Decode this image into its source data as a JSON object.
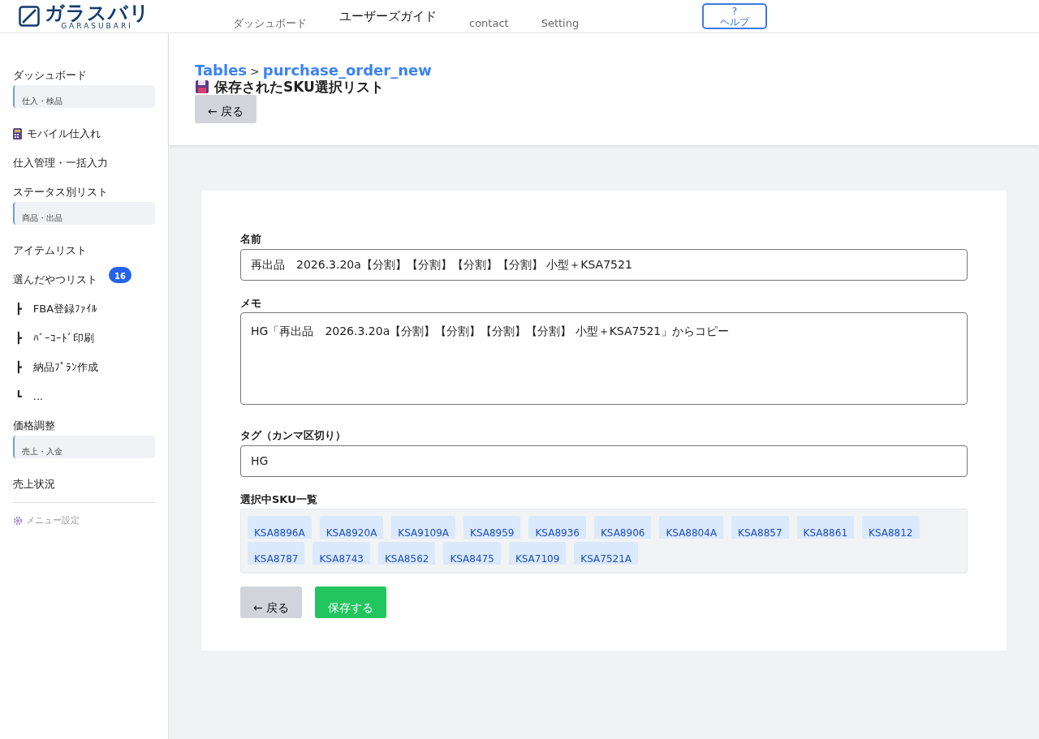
{
  "brand": {
    "name": "ガラスバリ",
    "subtitle": "GARASUBARI"
  },
  "topnav": [
    {
      "label": "ダッシュボード",
      "selected": false
    },
    {
      "label": "ユーザーズガイド",
      "selected": true
    },
    {
      "label": "contact",
      "selected": false
    },
    {
      "label": "Setting",
      "selected": false
    }
  ],
  "help_button": {
    "icon": "?",
    "label": "ヘルプ"
  },
  "sidebar": {
    "items": [
      {
        "kind": "link",
        "label": "ダッシュボード"
      },
      {
        "kind": "section",
        "label": "仕入・検品"
      },
      {
        "kind": "icon-link",
        "label": "モバイル仕入れ"
      },
      {
        "kind": "link",
        "label": "仕入管理・一括入力"
      },
      {
        "kind": "link",
        "label": "ステータス別リスト"
      },
      {
        "kind": "section",
        "label": "商品・出品"
      },
      {
        "kind": "link",
        "label": "アイテムリスト"
      },
      {
        "kind": "badge-link",
        "label": "選んだやつリスト",
        "badge": "16"
      },
      {
        "kind": "tree",
        "prefix": "┣",
        "label": "FBA登録ﾌｧｲﾙ"
      },
      {
        "kind": "tree",
        "prefix": "┣",
        "label": "ﾊﾞｰｺｰﾄﾞ印刷"
      },
      {
        "kind": "tree",
        "prefix": "┣",
        "label": "納品ﾌﾟﾗﾝ作成"
      },
      {
        "kind": "tree",
        "prefix": "┗",
        "label": "..."
      },
      {
        "kind": "link",
        "label": "価格調整"
      },
      {
        "kind": "section",
        "label": "売上・入金"
      },
      {
        "kind": "link",
        "label": "売上状況"
      }
    ],
    "settings": "メニュー設定"
  },
  "breadcrumb": {
    "parent": "Tables",
    "separator": ">",
    "current": "purchase_order_new"
  },
  "page_title": "保存されたSKU選択リスト",
  "header_back": "← 戻る",
  "form": {
    "fields": [
      {
        "kind": "input",
        "label": "名前",
        "value": "再出品　2026.3.20a【分割】【分割】【分割】【分割】 小型＋KSA7521"
      },
      {
        "kind": "textarea",
        "label": "メモ",
        "value": "HG「再出品　2026.3.20a【分割】【分割】【分割】【分割】 小型＋KSA7521」からコピー"
      },
      {
        "kind": "input",
        "label": "タグ（カンマ区切り）",
        "value": "HG"
      }
    ],
    "sku_label": "選択中SKU一覧",
    "skus": [
      "KSA8896A",
      "KSA8920A",
      "KSA9109A",
      "KSA8959",
      "KSA8936",
      "KSA8906",
      "KSA8804A",
      "KSA8857",
      "KSA8861",
      "KSA8812",
      "KSA8787",
      "KSA8743",
      "KSA8562",
      "KSA8475",
      "KSA7109",
      "KSA7521A"
    ],
    "back_button": "← 戻る",
    "save_button": "保存する"
  }
}
